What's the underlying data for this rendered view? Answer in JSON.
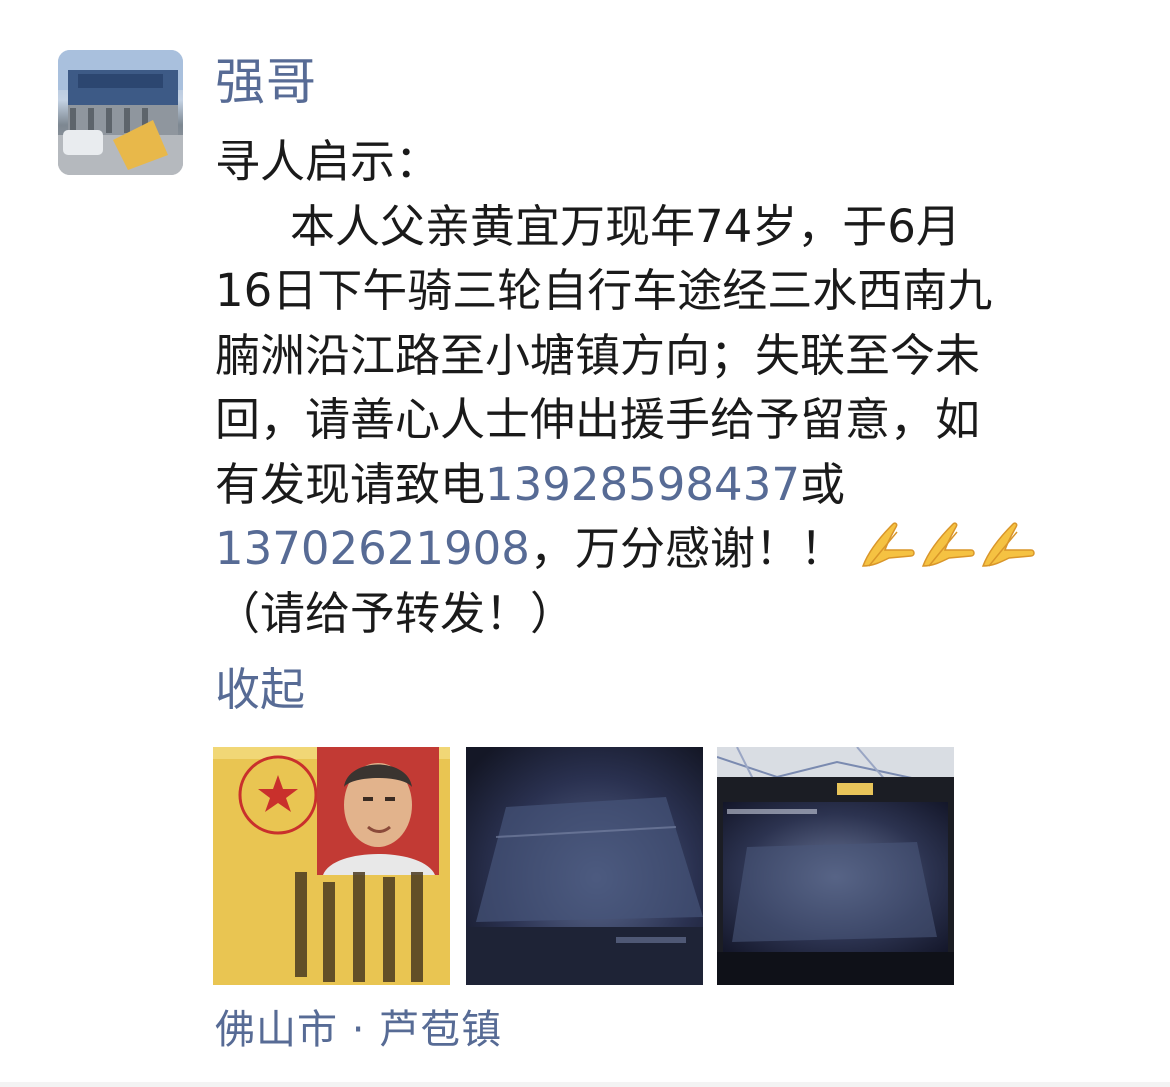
{
  "post": {
    "author": "强哥",
    "lines": [
      {
        "text": "寻人启示："
      },
      {
        "text": "本人父亲黄宜万现年74岁，于6月",
        "indent": true
      },
      {
        "text": "16日下午骑三轮自行车途经三水西南九"
      },
      {
        "text": "腩洲沿江路至小塘镇方向；失联至今未"
      },
      {
        "text": "回，请善心人士伸出援手给予留意，如"
      }
    ],
    "line6_prefix": "有发现请致电",
    "phone_1": "13928598437",
    "line6_suffix": "或",
    "phone_2": "13702621908",
    "line7_suffix": "，万分感谢！！",
    "emoji": "folded-hands-icon",
    "line8": "（请给予转发！）",
    "collapse_label": "收起",
    "photos": [
      {
        "name": "photo-id-card"
      },
      {
        "name": "photo-cctv-1"
      },
      {
        "name": "photo-cctv-2"
      }
    ],
    "location": "佛山市 · 芦苞镇"
  },
  "colors": {
    "link": "#576b95",
    "text": "#1a1a1a"
  }
}
